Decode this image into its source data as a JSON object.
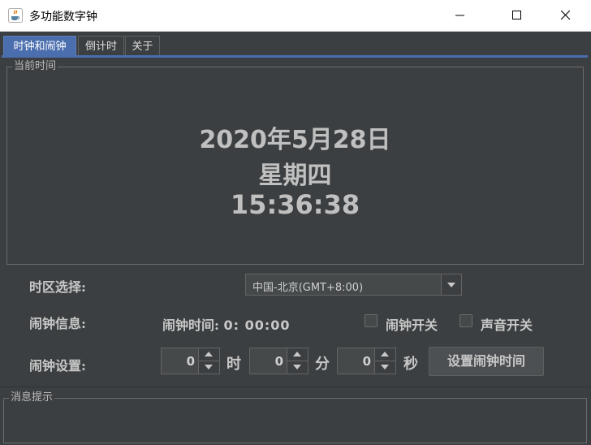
{
  "window": {
    "title": "多功能数字钟",
    "app_icon": "java-cup-icon",
    "controls": [
      "minimize-icon",
      "maximize-icon",
      "close-icon"
    ]
  },
  "tabs": [
    {
      "label": "时钟和闹钟",
      "active": true
    },
    {
      "label": "倒计时",
      "active": false
    },
    {
      "label": "关于",
      "active": false
    }
  ],
  "current_time": {
    "group_title": "当前时间",
    "date": "2020年5月28日",
    "weekday": "星期四",
    "time": "15:36:38"
  },
  "timezone": {
    "label": "时区选择:",
    "selected": "中国-北京(GMT+8:00)"
  },
  "alarm_info": {
    "label": "闹钟信息:",
    "key": "闹钟时间:",
    "value": "0: 00:00",
    "alarm_switch_label": "闹钟开关",
    "alarm_switch_checked": false,
    "sound_switch_label": "声音开关",
    "sound_switch_checked": false
  },
  "alarm_setting": {
    "label": "闹钟设置:",
    "hour_value": "0",
    "hour_unit": "时",
    "minute_value": "0",
    "minute_unit": "分",
    "second_value": "0",
    "second_unit": "秒",
    "set_button": "设置闹钟时间"
  },
  "messages": {
    "group_title": "消息提示"
  },
  "colors": {
    "background": "#3c3f41",
    "tab_active": "#4b6eaf",
    "text": "#bbbbbb"
  }
}
